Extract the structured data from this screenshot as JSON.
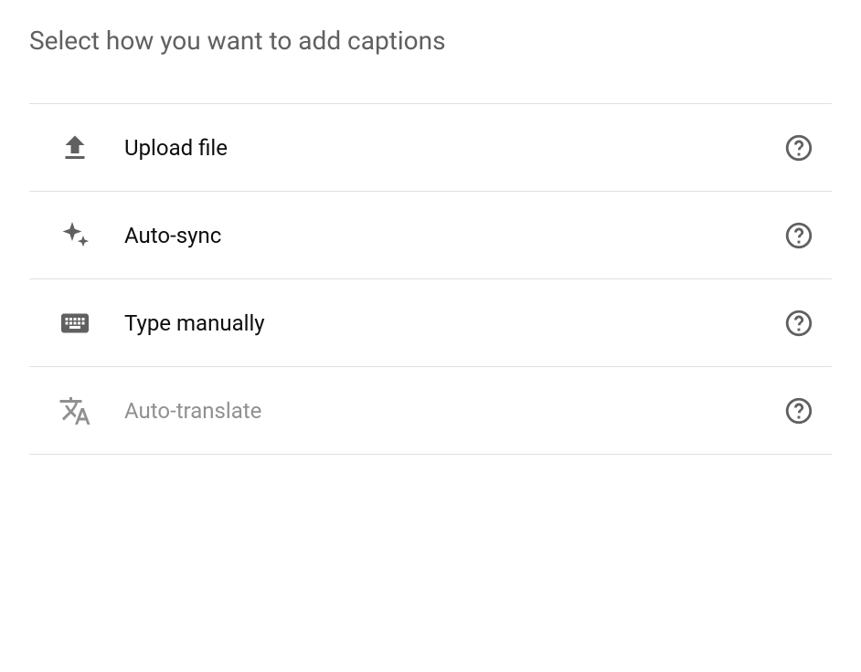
{
  "heading": "Select how you want to add captions",
  "options": [
    {
      "label": "Upload file",
      "icon": "upload-icon",
      "disabled": false
    },
    {
      "label": "Auto-sync",
      "icon": "sparkle-icon",
      "disabled": false
    },
    {
      "label": "Type manually",
      "icon": "keyboard-icon",
      "disabled": false
    },
    {
      "label": "Auto-translate",
      "icon": "translate-icon",
      "disabled": true
    }
  ]
}
